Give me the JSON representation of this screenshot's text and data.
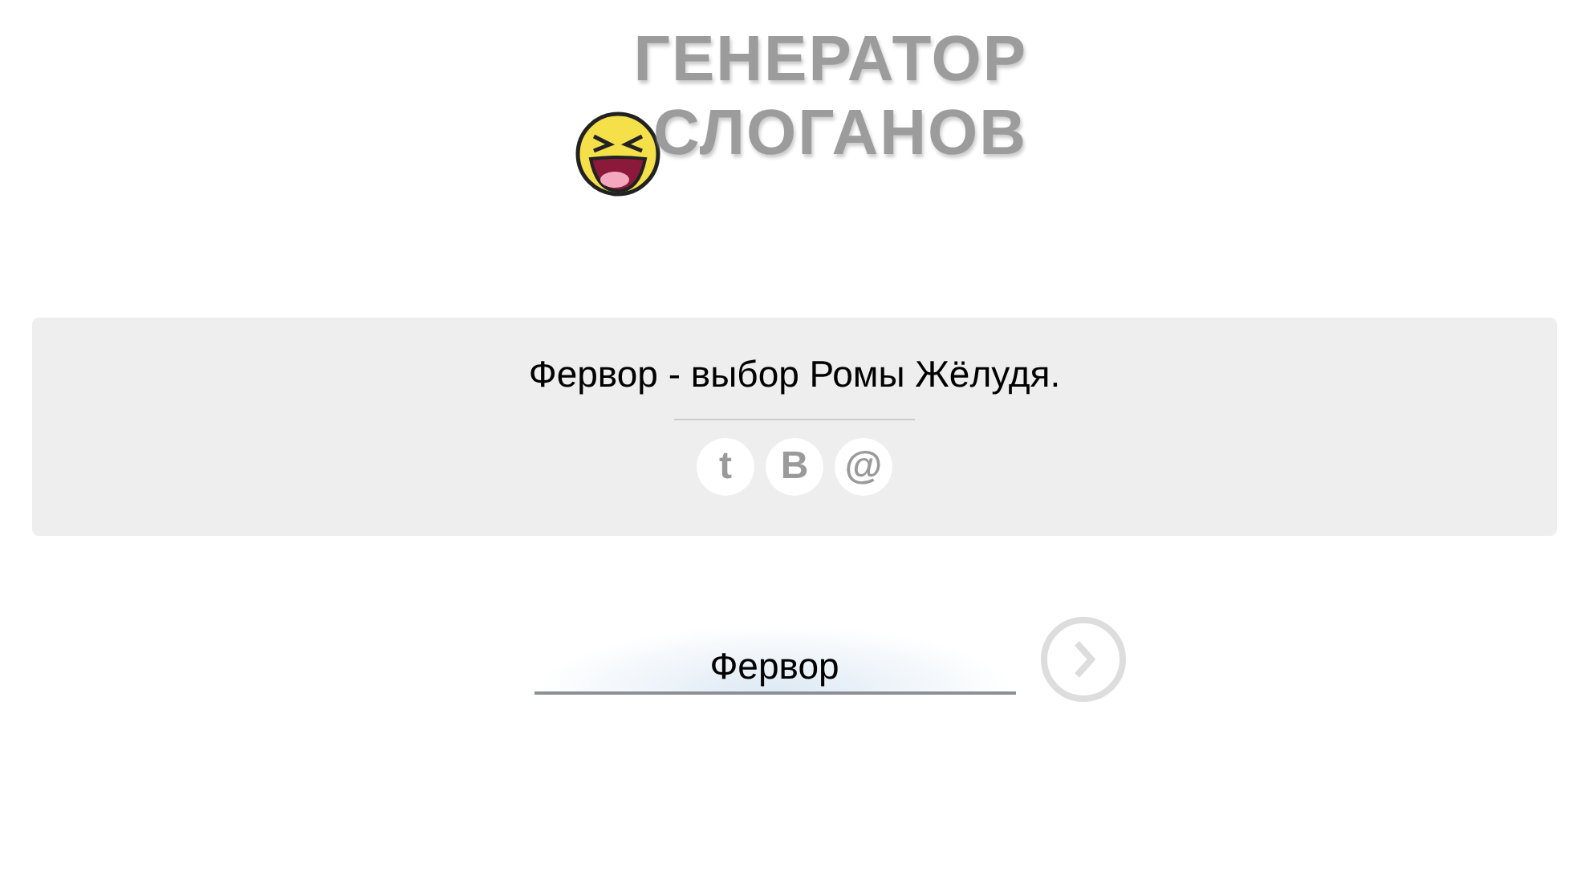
{
  "logo": {
    "lines": [
      "ГЕНЕРАТОР",
      "СЛОГАНОВ"
    ]
  },
  "result": {
    "slogan": "Фервор - выбор Ромы Жёлудя.",
    "share_buttons": [
      "t",
      "В",
      "@"
    ]
  },
  "form": {
    "value": "Фервор"
  }
}
